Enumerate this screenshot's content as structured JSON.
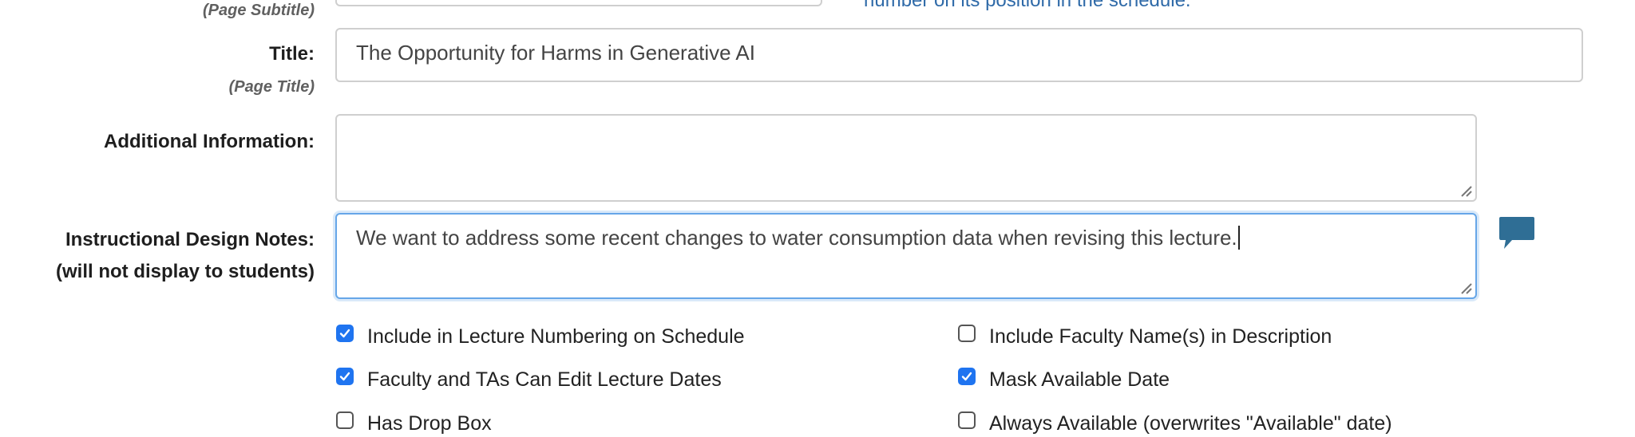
{
  "top": {
    "subtitle_hint": "(Page Subtitle)",
    "help_text_fragment": "number on its position in the schedule."
  },
  "title_row": {
    "label": "Title:",
    "hint": "(Page Title)",
    "value": "The Opportunity for Harms in Generative AI"
  },
  "additional_info": {
    "label": "Additional Information:",
    "value": ""
  },
  "design_notes": {
    "label_line1": "Instructional Design Notes:",
    "label_line2": "(will not display to students)",
    "value": "We want to address some recent changes to water consumption data when revising this lecture."
  },
  "checkboxes": {
    "left": [
      {
        "label": "Include in Lecture Numbering on Schedule",
        "checked": true
      },
      {
        "label": "Faculty and TAs Can Edit Lecture Dates",
        "checked": true
      },
      {
        "label": "Has Drop Box",
        "checked": false
      }
    ],
    "right": [
      {
        "label": "Include Faculty Name(s) in Description",
        "checked": false
      },
      {
        "label": "Mask Available Date",
        "checked": true
      },
      {
        "label": "Always Available (overwrites \"Available\" date)",
        "checked": false
      }
    ]
  },
  "colors": {
    "accent": "#1f74f0",
    "focus_border": "#66a6e8",
    "comment_icon": "#2f6e95",
    "help_text": "#2f6aa8"
  },
  "icons": {
    "comment": "comment-icon",
    "resize": "resize-grip-icon"
  }
}
